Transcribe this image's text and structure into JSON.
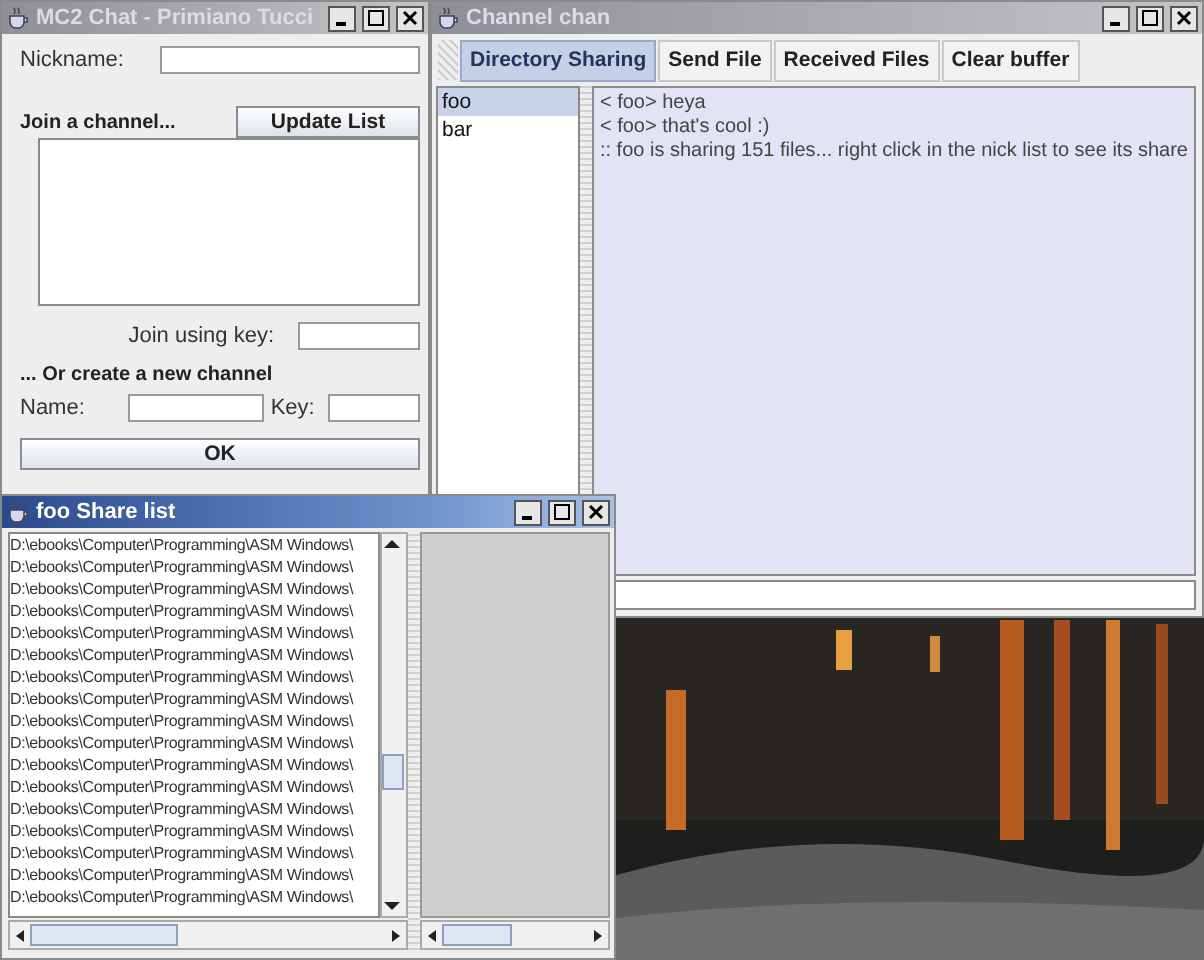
{
  "login_window": {
    "title": "MC2 Chat - Primiano Tucci",
    "active": false,
    "nickname_label": "Nickname:",
    "join_heading": "Join a channel...",
    "update_button": "Update List",
    "join_key_label": "Join using key:",
    "create_heading": "... Or create a new channel",
    "name_label": "Name:",
    "key_label": "Key:",
    "ok_button": "OK"
  },
  "channel_window": {
    "title": "Channel chan",
    "active": false,
    "toolbar": [
      {
        "label": "Directory Sharing",
        "selected": true
      },
      {
        "label": "Send File",
        "selected": false
      },
      {
        "label": "Received Files",
        "selected": false
      },
      {
        "label": "Clear buffer",
        "selected": false
      }
    ],
    "nicks": [
      {
        "name": "foo",
        "selected": true
      },
      {
        "name": "bar",
        "selected": false
      }
    ],
    "messages": [
      "< foo> heya",
      "< foo> that's cool :)",
      ":: foo is sharing 151 files... right click in the nick list to see its share"
    ]
  },
  "share_window": {
    "title": "foo Share list",
    "active": true,
    "files": [
      "D:\\ebooks\\Computer\\Programming\\ASM Windows\\",
      "D:\\ebooks\\Computer\\Programming\\ASM Windows\\",
      "D:\\ebooks\\Computer\\Programming\\ASM Windows\\",
      "D:\\ebooks\\Computer\\Programming\\ASM Windows\\",
      "D:\\ebooks\\Computer\\Programming\\ASM Windows\\",
      "D:\\ebooks\\Computer\\Programming\\ASM Windows\\",
      "D:\\ebooks\\Computer\\Programming\\ASM Windows\\",
      "D:\\ebooks\\Computer\\Programming\\ASM Windows\\",
      "D:\\ebooks\\Computer\\Programming\\ASM Windows\\",
      "D:\\ebooks\\Computer\\Programming\\ASM Windows\\",
      "D:\\ebooks\\Computer\\Programming\\ASM Windows\\",
      "D:\\ebooks\\Computer\\Programming\\ASM Windows\\",
      "D:\\ebooks\\Computer\\Programming\\ASM Windows\\",
      "D:\\ebooks\\Computer\\Programming\\ASM Windows\\",
      "D:\\ebooks\\Computer\\Programming\\ASM Windows\\",
      "D:\\ebooks\\Computer\\Programming\\ASM Windows\\",
      "D:\\ebooks\\Computer\\Programming\\ASM Windows\\"
    ]
  }
}
